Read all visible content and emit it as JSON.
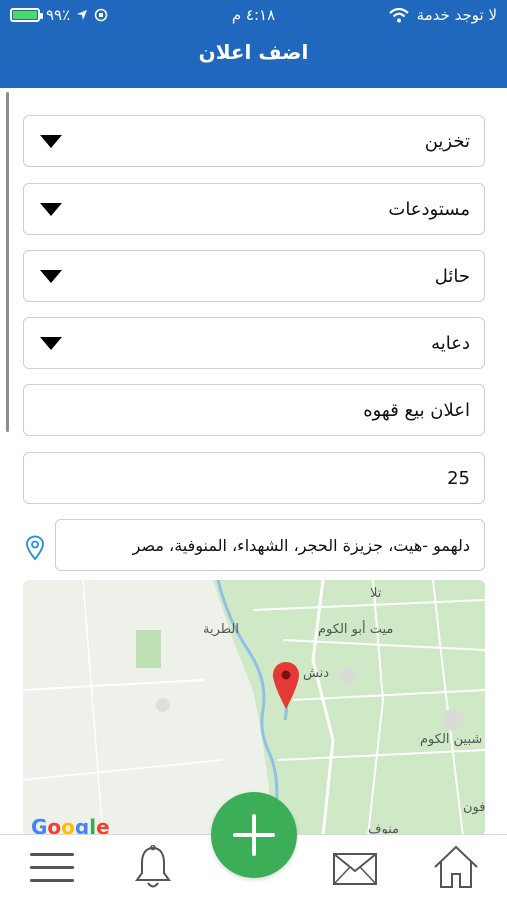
{
  "status_bar": {
    "carrier": "لا توجد خدمة",
    "time": "٤:١٨ م",
    "battery": "٩٩٪",
    "battery_level": 0.99
  },
  "header": {
    "title": "اضف اعلان"
  },
  "form": {
    "category": "تخزين",
    "subcategory": "مستودعات",
    "type": "حائل",
    "ad_kind": "دعايه",
    "ad_title": "اعلان بيع قهوه",
    "price": "25",
    "location": "دلهمو -هيت، جزيزة الحجر، الشهداء، المنوفية، مصر"
  },
  "map": {
    "labels": {
      "tala": "تلا",
      "tarya": "الطرية",
      "mit_abu_elkom": "ميت أبو الكوم",
      "danash": "دنش",
      "shebin": "شبين الكوم",
      "fon": "فون",
      "monof": "منوف"
    },
    "attribution": "Google"
  },
  "colors": {
    "header": "#1f68bd",
    "fab": "#3cae58",
    "pin": "#e53935"
  },
  "icons": {
    "menu": "menu-icon",
    "bell": "bell-icon",
    "add": "plus-icon",
    "mail": "mail-icon",
    "home": "home-icon",
    "location": "location-pin-icon"
  }
}
